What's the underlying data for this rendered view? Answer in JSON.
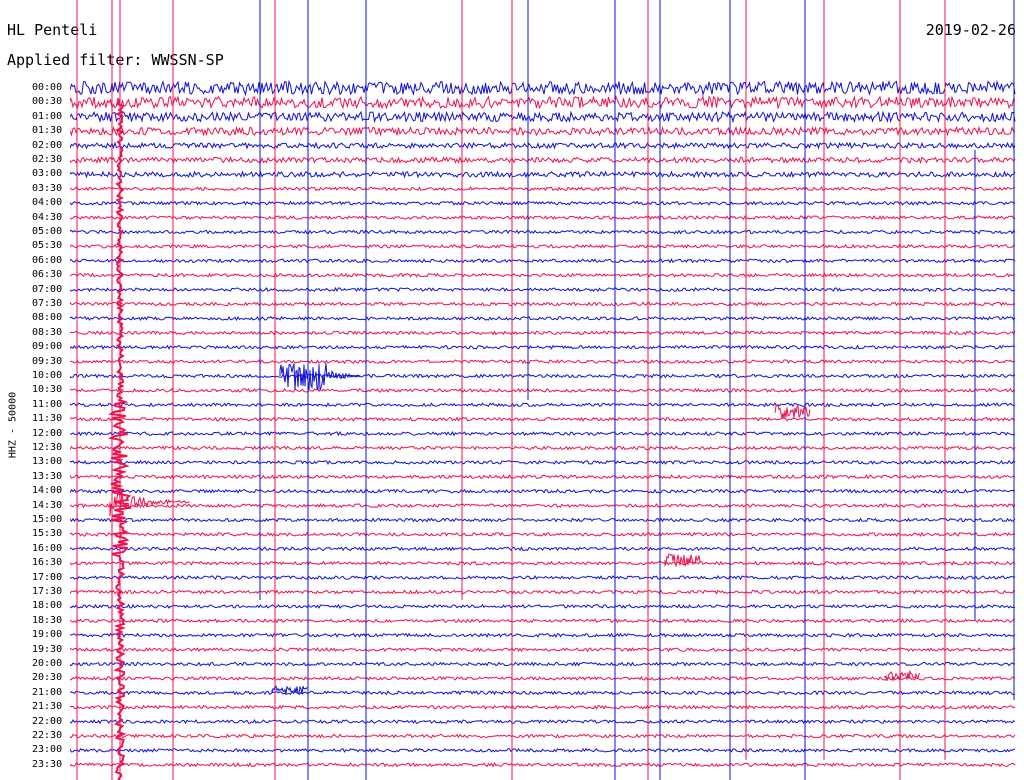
{
  "header": {
    "station": "HL Penteli",
    "filter": "Applied filter: WWSSN-SP",
    "date": "2019-02-26"
  },
  "channel": "HHZ - 50000",
  "time_labels": [
    "00:00",
    "00:30",
    "01:00",
    "01:30",
    "02:00",
    "02:30",
    "03:00",
    "03:30",
    "04:00",
    "04:30",
    "05:00",
    "05:30",
    "06:00",
    "06:30",
    "07:00",
    "07:30",
    "08:00",
    "08:30",
    "09:00",
    "09:30",
    "10:00",
    "10:30",
    "11:00",
    "11:30",
    "12:00",
    "12:30",
    "13:00",
    "13:30",
    "14:00",
    "14:30",
    "15:00",
    "15:30",
    "16:00",
    "16:30",
    "17:00",
    "17:30",
    "18:00",
    "18:30",
    "19:00",
    "19:30",
    "20:00",
    "20:30",
    "21:00",
    "21:30",
    "22:00",
    "22:30",
    "23:00",
    "23:30"
  ],
  "colors": {
    "trace_even": "#1010d8",
    "trace_odd": "#f0104c",
    "text": "#000000",
    "background": "#ffffff"
  }
}
